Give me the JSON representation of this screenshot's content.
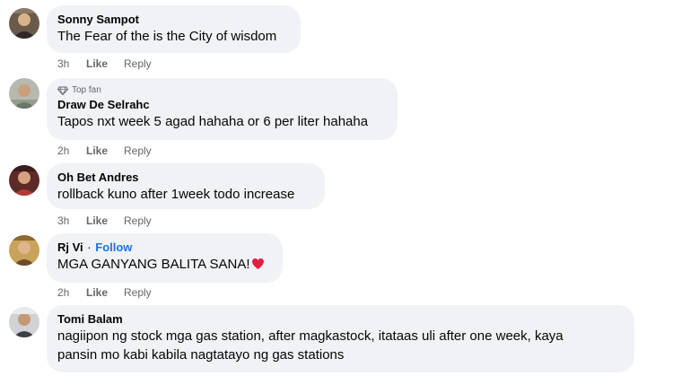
{
  "comments": [
    {
      "author": "Sonny Sampot",
      "text": "The Fear of the is the City of wisdom",
      "time": "3h",
      "like": "Like",
      "reply": "Reply"
    },
    {
      "badge": "Top fan",
      "author": "Draw De Selrahc",
      "text": "Tapos nxt week 5 agad hahaha or 6 per liter hahaha",
      "time": "2h",
      "like": "Like",
      "reply": "Reply"
    },
    {
      "author": "Oh Bet Andres",
      "text": "rollback kuno after 1week todo increase",
      "time": "3h",
      "like": "Like",
      "reply": "Reply"
    },
    {
      "author": "Rj Vi",
      "separator": "·",
      "follow": "Follow",
      "text": "MGA GANYANG BALITA SANA!",
      "time": "2h",
      "like": "Like",
      "reply": "Reply"
    },
    {
      "author": "Tomi Balam",
      "text_line1": "nagiipon ng stock mga gas station, after magkastock, itataas uli after one week, kaya",
      "text_line2": "pansin mo kabi kabila nagtatayo ng gas stations"
    }
  ],
  "icons": {
    "top_fan": "diamond-icon",
    "reaction": "red-heart-icon"
  },
  "colors": {
    "bubble_bg": "#f0f2f5",
    "follow": "#1b74e4",
    "meta_text": "#65676b",
    "heart": "#e41e3f"
  }
}
